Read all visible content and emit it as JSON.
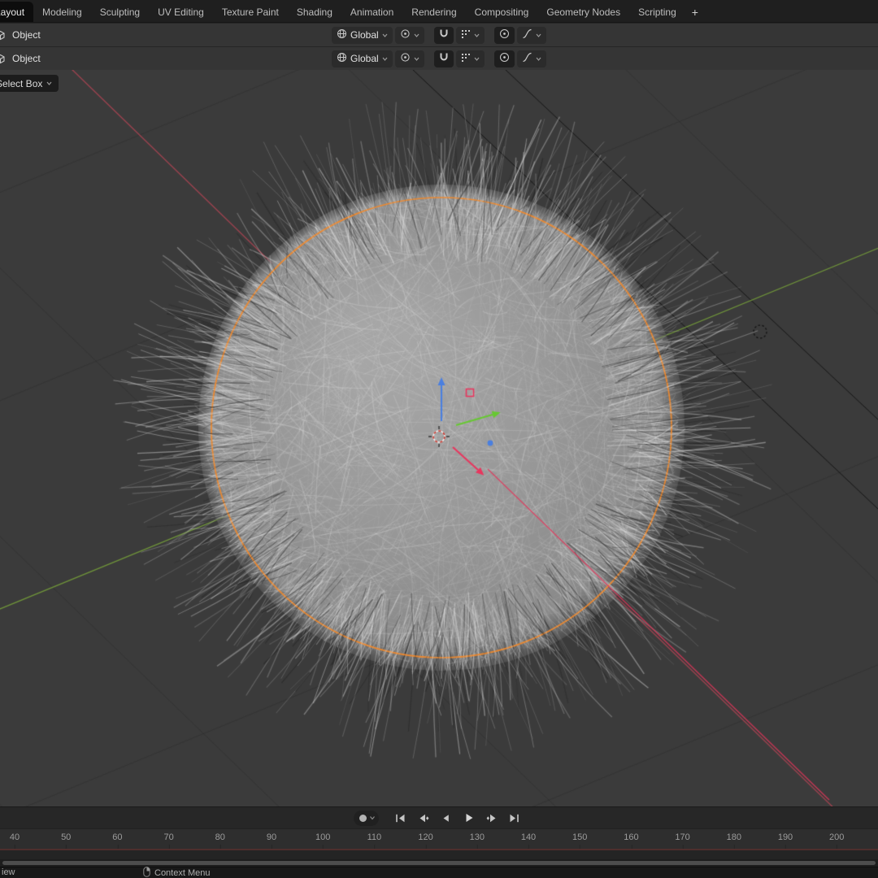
{
  "topbar": {
    "tabs": [
      "Layout",
      "Modeling",
      "Sculpting",
      "UV Editing",
      "Texture Paint",
      "Shading",
      "Animation",
      "Rendering",
      "Compositing",
      "Geometry Nodes",
      "Scripting"
    ],
    "active_tab": "Layout",
    "add_button": "+"
  },
  "viewport_headers": [
    {
      "mode_label": "Object",
      "orientation_label": "Global"
    },
    {
      "mode_label": "Object",
      "orientation_label": "Global"
    }
  ],
  "tool_selector": {
    "label": "Select Box"
  },
  "transport": {
    "buttons": [
      "record",
      "keying-popover",
      "jump-to-start",
      "previous-keyframe",
      "play-reverse",
      "play",
      "next-keyframe",
      "jump-to-end"
    ]
  },
  "timeline": {
    "ticks": [
      "40",
      "50",
      "60",
      "70",
      "80",
      "90",
      "100",
      "110",
      "120",
      "130",
      "140",
      "150",
      "160",
      "170",
      "180",
      "190",
      "200"
    ]
  },
  "statusbar": {
    "left_fragment": "iew",
    "hint": "Context Menu"
  },
  "colors": {
    "accent_orange": "#f0892c",
    "axis_x_red": "rgba(172,68,82,0.9)",
    "axis_y_green": "rgba(118,158,58,0.9)",
    "gizmo_x": "#e8365e",
    "gizmo_y": "#67c832",
    "gizmo_z": "#4a7fe0",
    "hair": "#c9c9c9"
  }
}
